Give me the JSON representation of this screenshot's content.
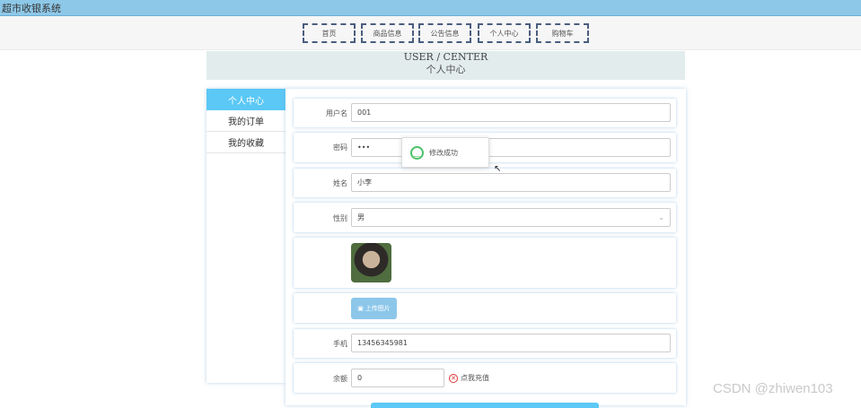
{
  "app": {
    "title": "超市收银系统"
  },
  "nav": {
    "items": [
      "首页",
      "商品信息",
      "公告信息",
      "个人中心",
      "购物车"
    ]
  },
  "banner": {
    "en": "USER / CENTER",
    "cn": "个人中心"
  },
  "sidebar": {
    "items": [
      "个人中心",
      "我的订单",
      "我的收藏"
    ],
    "active": "个人中心"
  },
  "form": {
    "username": {
      "label": "用户名",
      "value": "001"
    },
    "password": {
      "label": "密码",
      "value": "•••"
    },
    "name": {
      "label": "姓名",
      "value": "小李"
    },
    "gender": {
      "label": "性别",
      "value": "男"
    },
    "upload_label": "上传图片",
    "phone": {
      "label": "手机",
      "value": "13456345981"
    },
    "balance": {
      "label": "余额",
      "value": "0",
      "recharge_label": "点我充值"
    }
  },
  "toast": {
    "message": "修改成功"
  },
  "watermark": "CSDN @zhiwen103",
  "colors": {
    "accent": "#5bc8f5",
    "titlebar": "#8ec8e8",
    "success": "#4cc26a"
  }
}
